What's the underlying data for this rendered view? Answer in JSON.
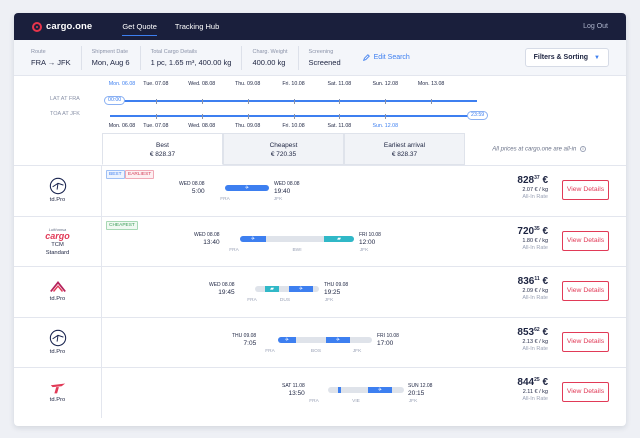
{
  "nav": {
    "brand": "cargo.one",
    "links": [
      "Get Quote",
      "Tracking Hub"
    ],
    "logout": "Log Out"
  },
  "summary": {
    "route_label": "Route",
    "route_from": "FRA",
    "route_to": "JFK",
    "date_label": "Shipment Date",
    "date_value": "Mon, Aug 6",
    "details_label": "Total Cargo Details",
    "details_value": "1 pc, 1.65 m³, 400.00 kg",
    "weight_label": "Charg. Weight",
    "weight_value": "400.00 kg",
    "screening_label": "Screening",
    "screening_value": "Screened",
    "edit_search": "Edit Search",
    "filters": "Filters & Sorting"
  },
  "timeline": {
    "lat_label": "LAT AT FRA",
    "toa_label": "TOA AT JFK",
    "lat_dates": [
      "Mon. 06.08",
      "Tue. 07.08",
      "Wed. 08.08",
      "Thu. 09.08",
      "Fri. 10.08",
      "Sat. 11.08",
      "Sun. 12.08",
      "Mon. 13.08"
    ],
    "toa_dates": [
      "Mon. 06.08",
      "Tue. 07.08",
      "Wed. 08.08",
      "Thu. 09.08",
      "Fri. 10.08",
      "Sat. 11.08",
      "Sun. 12.08"
    ],
    "lat_time": "00:00",
    "toa_time": "23:59"
  },
  "sort_tabs": [
    {
      "title": "Best",
      "price": "€ 828.37"
    },
    {
      "title": "Cheapest",
      "price": "€ 720.35"
    },
    {
      "title": "Earliest arrival",
      "price": "€ 828.37"
    }
  ],
  "allin_note": "All prices at cargo.one are all-in",
  "rows": [
    {
      "carrier": "td.Pro",
      "logo": "crane-logo",
      "badges": [
        "BEST",
        "EARLIEST"
      ],
      "dep_day": "WED 08.08",
      "dep_time": "5:00",
      "arr_day": "WED 08.08",
      "arr_time": "19:40",
      "airports": [
        "FRA",
        "JFK"
      ],
      "price_main": "828",
      "price_cents": "37",
      "currency": "€",
      "per_kg": "2.07 € / kg",
      "rate": "All-In Rate",
      "button": "View Details"
    },
    {
      "carrier": "TCM\nStandard",
      "logo": "cargo-logo",
      "logo_text": "cargo",
      "logo_sub": "Lufthansa",
      "badges": [
        "CHEAPEST"
      ],
      "dep_day": "WED 08.08",
      "dep_time": "13:40",
      "arr_day": "FRI 10.08",
      "arr_time": "12:00",
      "airports": [
        "FRA",
        "BWI",
        "JFK"
      ],
      "price_main": "720",
      "price_cents": "35",
      "currency": "€",
      "per_kg": "1.80 € / kg",
      "rate": "All-In Rate",
      "button": "View Details"
    },
    {
      "carrier": "td.Pro",
      "logo": "eurowings-logo",
      "badges": [],
      "dep_day": "WED 08.08",
      "dep_time": "19:45",
      "arr_day": "THU 09.08",
      "arr_time": "19:25",
      "airports": [
        "FRA",
        "DUS",
        "JFK"
      ],
      "price_main": "836",
      "price_cents": "11",
      "currency": "€",
      "per_kg": "2.09 € / kg",
      "rate": "All-In Rate",
      "button": "View Details"
    },
    {
      "carrier": "td.Pro",
      "logo": "crane-logo",
      "badges": [],
      "dep_day": "THU 09.08",
      "dep_time": "7:05",
      "arr_day": "FRI 10.08",
      "arr_time": "17:00",
      "airports": [
        "FRA",
        "BOS",
        "JFK"
      ],
      "price_main": "853",
      "price_cents": "62",
      "currency": "€",
      "per_kg": "2.13 € / kg",
      "rate": "All-In Rate",
      "button": "View Details"
    },
    {
      "carrier": "td.Pro",
      "logo": "austrian-logo",
      "badges": [],
      "dep_day": "SAT 11.08",
      "dep_time": "13:50",
      "arr_day": "SUN 12.08",
      "arr_time": "20:15",
      "airports": [
        "FRA",
        "VIE",
        "JFK"
      ],
      "price_main": "844",
      "price_cents": "25",
      "currency": "€",
      "per_kg": "2.11 € / kg",
      "rate": "All-In Rate",
      "button": "View Details"
    }
  ]
}
